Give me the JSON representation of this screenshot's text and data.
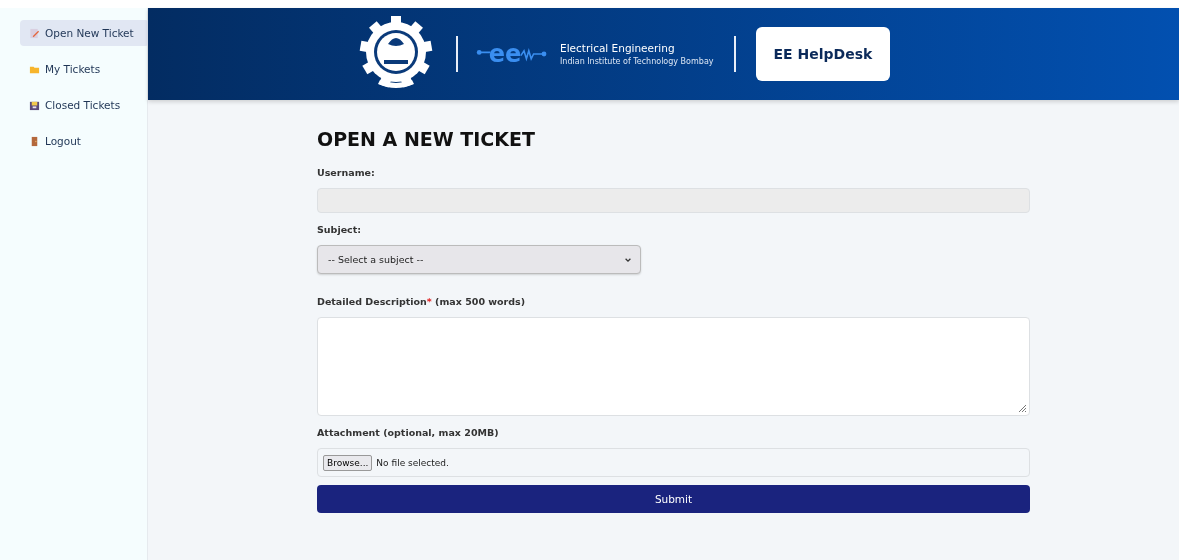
{
  "sidebar": {
    "items": [
      {
        "label": "Open New Ticket",
        "kind": "new",
        "selected": true
      },
      {
        "label": "My Tickets",
        "kind": "open",
        "selected": false
      },
      {
        "label": "Closed Tickets",
        "kind": "closed",
        "selected": false
      },
      {
        "label": "Logout",
        "kind": "logout",
        "selected": false
      }
    ]
  },
  "header": {
    "logo_mark": "ee",
    "department": "Electrical Engineering",
    "institute": "Indian Institute of Technology Bombay",
    "app_name": "EE HelpDesk"
  },
  "form": {
    "title": "OPEN A NEW TICKET",
    "username": {
      "label": "Username:"
    },
    "subject": {
      "label": "Subject:",
      "value": "-- Select a subject --"
    },
    "description": {
      "label": "Detailed Description",
      "required_mark": "*",
      "hint": " (max 500 words)"
    },
    "attachment": {
      "label": "Attachment (optional, max 20MB)",
      "browse": "Browse...",
      "status": "No file selected."
    },
    "submit": "Submit"
  }
}
